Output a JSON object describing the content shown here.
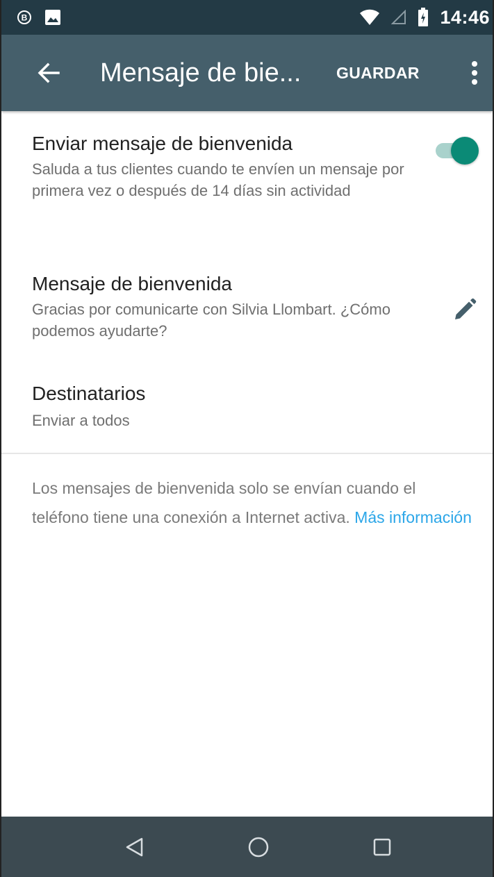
{
  "status_bar": {
    "time": "14:46",
    "icons": [
      "whatsapp-business-icon",
      "image-notification-icon",
      "wifi-icon",
      "signal-icon",
      "battery-icon"
    ]
  },
  "app_bar": {
    "title": "Mensaje de bie...",
    "save_label": "GUARDAR",
    "icons": [
      "back-arrow-icon",
      "more-vert-icon"
    ]
  },
  "settings": {
    "send_welcome": {
      "title": "Enviar mensaje de bienvenida",
      "subtitle": "Saluda a tus clientes cuando te envíen un mensaje por primera vez o después de 14 días sin actividad",
      "enabled": true
    },
    "welcome_message": {
      "title": "Mensaje de bienvenida",
      "subtitle": "Gracias por comunicarte con Silvia Llombart. ¿Cómo podemos ayudarte?",
      "icon": "pencil-icon"
    },
    "recipients": {
      "title": "Destinatarios",
      "subtitle": "Enviar a todos"
    }
  },
  "info": {
    "text": "Los mensajes de bienvenida solo se envían cuando el teléfono tiene una conexión a Internet activa.",
    "link": "Más información"
  },
  "nav_bar": {
    "icons": [
      "nav-back-icon",
      "nav-home-icon",
      "nav-recents-icon"
    ]
  },
  "colors": {
    "status_bar": "#233a45",
    "app_bar": "#455f6b",
    "toggle_thumb": "#0b8a76",
    "toggle_track": "#a9d2cc",
    "link": "#2ba6e8",
    "nav_bar": "#3c4a51"
  }
}
